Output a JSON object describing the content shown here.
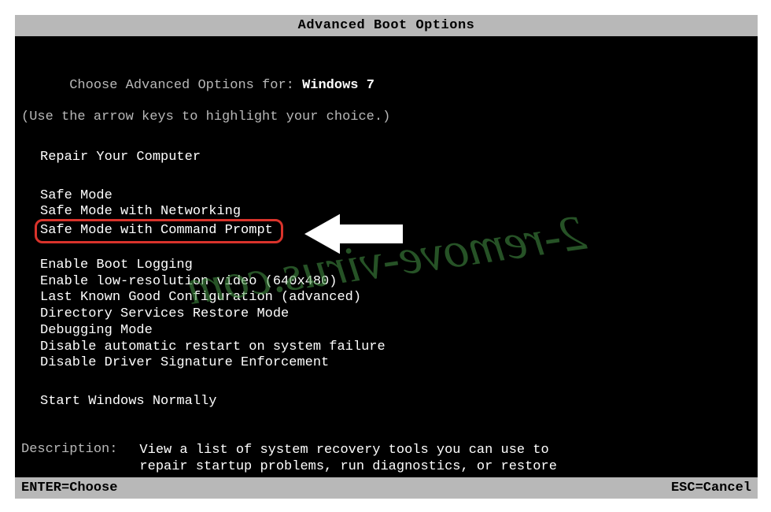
{
  "title": "Advanced Boot Options",
  "choose_prefix": "Choose Advanced Options for: ",
  "os_name": "Windows 7",
  "hint": "(Use the arrow keys to highlight your choice.)",
  "menu": {
    "group1": [
      "Repair Your Computer"
    ],
    "group2": [
      "Safe Mode",
      "Safe Mode with Networking",
      "Safe Mode with Command Prompt"
    ],
    "group3": [
      "Enable Boot Logging",
      "Enable low-resolution video (640x480)",
      "Last Known Good Configuration (advanced)",
      "Directory Services Restore Mode",
      "Debugging Mode",
      "Disable automatic restart on system failure",
      "Disable Driver Signature Enforcement"
    ],
    "group4": [
      "Start Windows Normally"
    ],
    "highlighted_index": 2
  },
  "description": {
    "label": "Description:",
    "text": "View a list of system recovery tools you can use to repair startup problems, run diagnostics, or restore your system."
  },
  "footer": {
    "left": "ENTER=Choose",
    "right": "ESC=Cancel"
  },
  "watermark": "2-remove-virus.com",
  "colors": {
    "highlight_border": "#d9332b",
    "text_dim": "#b8b8b8",
    "text_bright": "#ffffff",
    "watermark": "rgba(70,150,70,0.55)"
  }
}
